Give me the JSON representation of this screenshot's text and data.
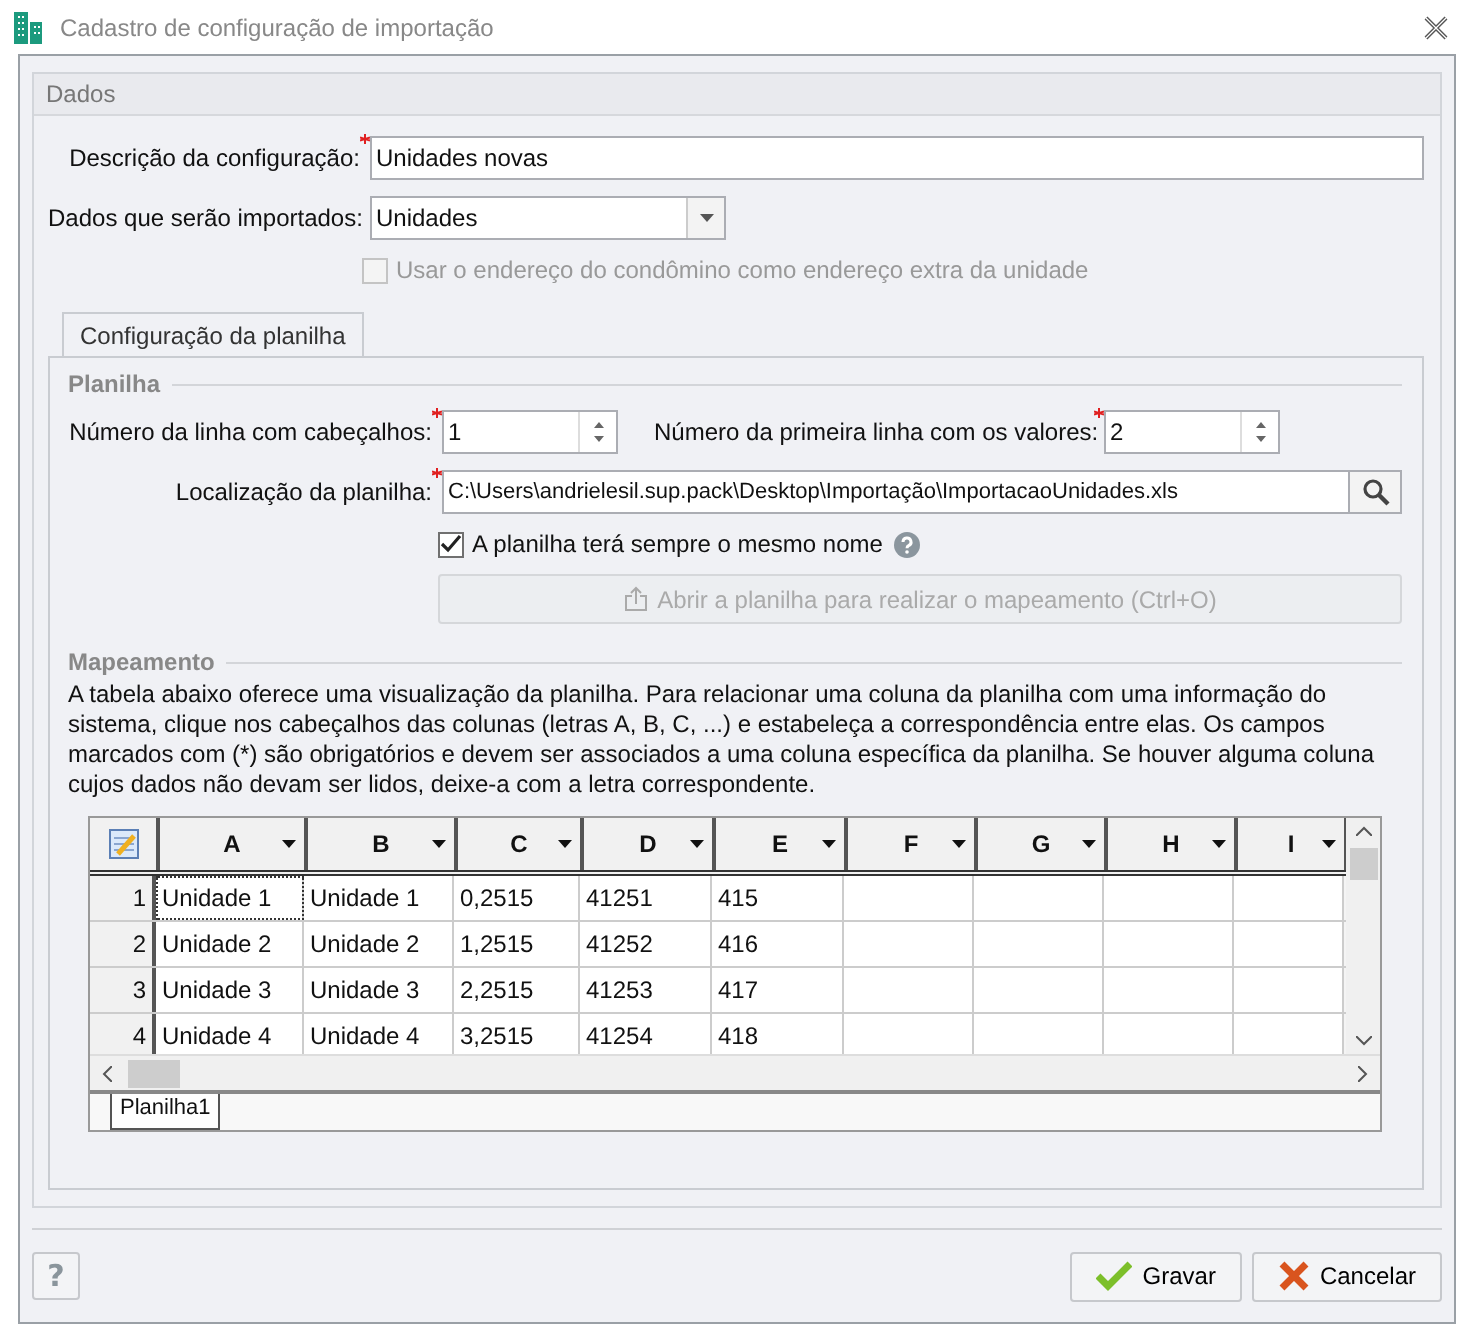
{
  "window": {
    "title": "Cadastro de configuração de importação"
  },
  "dados": {
    "title": "Dados",
    "descricao": {
      "label": "Descrição da configuração:",
      "required": true,
      "value": "Unidades novas"
    },
    "dados_importados": {
      "label": "Dados que serão importados:",
      "value": "Unidades"
    },
    "usar_endereco": {
      "label": "Usar o endereço do condômino como endereço extra da unidade",
      "checked": false,
      "disabled": true
    }
  },
  "tabs": [
    {
      "label": "Configuração da planilha",
      "selected": true
    }
  ],
  "planilha": {
    "title": "Planilha",
    "linha_cabecalhos": {
      "label": "Número da linha com cabeçalhos:",
      "required": true,
      "value": "1"
    },
    "primeira_linha": {
      "label": "Número da primeira linha com os valores:",
      "required": true,
      "value": "2"
    },
    "localizacao": {
      "label": "Localização da planilha:",
      "required": true,
      "value": "C:\\Users\\andrielesil.sup.pack\\Desktop\\Importação\\ImportacaoUnidades.xls"
    },
    "mesmo_nome": {
      "label": "A planilha terá sempre o mesmo nome",
      "checked": true,
      "disabled": false
    },
    "abrir_button": {
      "label": "Abrir a planilha para realizar o mapeamento (Ctrl+O)",
      "disabled": true
    }
  },
  "mapeamento": {
    "title": "Mapeamento",
    "description": "A tabela abaixo oferece uma visualização da planilha. Para relacionar uma coluna da planilha com uma informação do sistema, clique nos cabeçalhos das colunas (letras A, B, C, ...) e estabeleça a correspondência entre elas. Os campos marcados com (*) são obrigatórios e devem ser associados a uma coluna específica da planilha. Se houver alguma coluna cujos dados não devam ser lidos, deixe-a com a letra correspondente.",
    "grid": {
      "columns": [
        "A",
        "B",
        "C",
        "D",
        "E",
        "F",
        "G",
        "H",
        "I"
      ],
      "rows": [
        {
          "number": "1",
          "cells": [
            "Unidade 1",
            "Unidade 1",
            "0,2515",
            "41251",
            "415"
          ]
        },
        {
          "number": "2",
          "cells": [
            "Unidade 2",
            "Unidade 2",
            "1,2515",
            "41252",
            "416"
          ]
        },
        {
          "number": "3",
          "cells": [
            "Unidade 3",
            "Unidade 3",
            "2,2515",
            "41253",
            "417"
          ]
        },
        {
          "number": "4",
          "cells": [
            "Unidade 4",
            "Unidade 4",
            "3,2515",
            "41254",
            "418"
          ]
        }
      ],
      "sheets": [
        {
          "label": "Planilha1",
          "selected": true
        }
      ]
    }
  },
  "footer": {
    "help": "?",
    "buttons": [
      {
        "kind": "save",
        "label": "Gravar"
      },
      {
        "kind": "cancel",
        "label": "Cancelar"
      }
    ]
  }
}
